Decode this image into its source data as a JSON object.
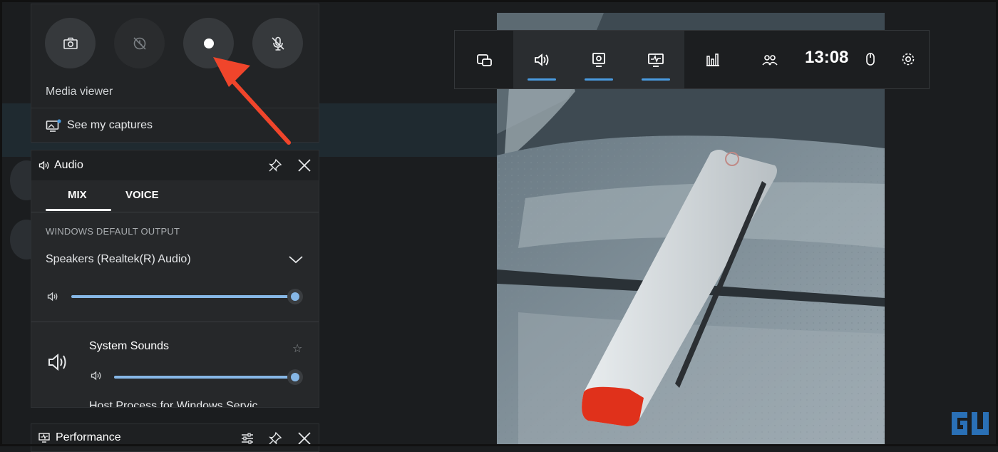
{
  "capture": {
    "buttons": [
      {
        "icon": "camera-icon",
        "label": "Take screenshot"
      },
      {
        "icon": "record-last-icon",
        "label": "Record last 30 sec"
      },
      {
        "icon": "record-dot-icon",
        "label": "Start recording"
      },
      {
        "icon": "mic-off-icon",
        "label": "Microphone off"
      }
    ],
    "media_viewer_label": "Media viewer",
    "see_captures_label": "See my captures"
  },
  "audio": {
    "title": "Audio",
    "tabs": [
      {
        "label": "MIX",
        "active": true
      },
      {
        "label": "VOICE",
        "active": false
      }
    ],
    "section_title": "WINDOWS DEFAULT OUTPUT",
    "device": "Speakers (Realtek(R) Audio)",
    "master_volume": 1.0,
    "apps": [
      {
        "name": "System Sounds",
        "volume": 1.0
      },
      {
        "name": "Host Process for Windows Servic"
      }
    ]
  },
  "performance": {
    "title": "Performance"
  },
  "gamebar": {
    "clock": "13:08",
    "widgets": [
      "widget-menu-icon",
      "audio-icon",
      "capture-icon",
      "performance-icon",
      "resources-icon",
      "social-icon"
    ],
    "active_widgets": [
      "audio-icon",
      "capture-icon",
      "performance-icon"
    ],
    "accent_color": "#4a9be0"
  },
  "annotation": {
    "arrow_color": "#f0452b"
  }
}
